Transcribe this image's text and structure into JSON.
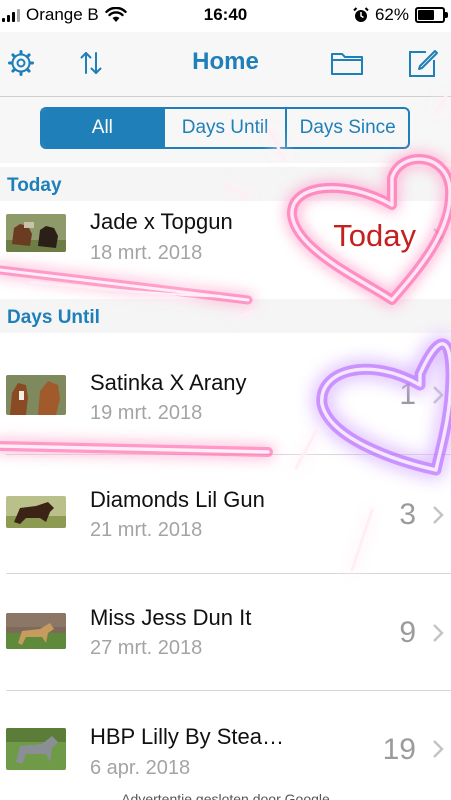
{
  "status_bar": {
    "carrier": "Orange B",
    "time": "16:40",
    "battery": "62%",
    "icons": [
      "signal-bars-icon",
      "wifi-icon",
      "alarm-icon",
      "battery-icon"
    ]
  },
  "navbar": {
    "title": "Home",
    "icons": [
      "gear-icon",
      "sort-arrows-icon",
      "folder-icon",
      "compose-icon"
    ]
  },
  "segments": [
    {
      "label": "All",
      "active": true
    },
    {
      "label": "Days Until",
      "active": false
    },
    {
      "label": "Days Since",
      "active": false
    }
  ],
  "sections": {
    "today": "Today",
    "days_until": "Days Until"
  },
  "rows": [
    {
      "title": "Jade x Topgun",
      "date": "18 mrt. 2018",
      "count": "Today"
    },
    {
      "title": "Satinka X Arany",
      "date": "19 mrt. 2018",
      "count": "1"
    },
    {
      "title": "Diamonds Lil Gun",
      "date": "21 mrt. 2018",
      "count": "3"
    },
    {
      "title": "Miss Jess Dun It",
      "date": "27 mrt. 2018",
      "count": "9"
    },
    {
      "title": "HBP Lilly By Stea…",
      "date": "6 apr. 2018",
      "count": "19"
    }
  ],
  "ad_footer": "Advertentie gesloten door Google",
  "colors": {
    "accent": "#1f7fb8",
    "today_text": "#c3201f",
    "muted": "#a4a4a4",
    "neon_pink": "#ff3fa6",
    "neon_purple": "#b04dff"
  }
}
